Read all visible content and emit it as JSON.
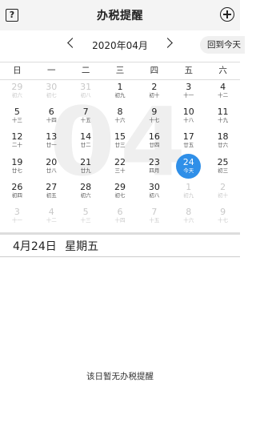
{
  "header": {
    "help_icon_glyph": "?",
    "help_icon": "question-icon",
    "title": "办税提醒",
    "add_icon": "plus-circle-icon"
  },
  "month_nav": {
    "prev_icon": "chevron-left-icon",
    "label": "2020年04月",
    "next_icon": "chevron-right-icon",
    "today_button": "回到今天"
  },
  "weekdays": [
    "日",
    "一",
    "二",
    "三",
    "四",
    "五",
    "六"
  ],
  "watermark": "04",
  "calendar": {
    "selected_color": "#2f8fe8",
    "days": [
      {
        "day": "29",
        "lunar": "初六",
        "other": true
      },
      {
        "day": "30",
        "lunar": "初七",
        "other": true
      },
      {
        "day": "31",
        "lunar": "初八",
        "other": true
      },
      {
        "day": "1",
        "lunar": "初九"
      },
      {
        "day": "2",
        "lunar": "初十"
      },
      {
        "day": "3",
        "lunar": "十一"
      },
      {
        "day": "4",
        "lunar": "十二"
      },
      {
        "day": "5",
        "lunar": "十三"
      },
      {
        "day": "6",
        "lunar": "十四"
      },
      {
        "day": "7",
        "lunar": "十五"
      },
      {
        "day": "8",
        "lunar": "十六"
      },
      {
        "day": "9",
        "lunar": "十七"
      },
      {
        "day": "10",
        "lunar": "十八"
      },
      {
        "day": "11",
        "lunar": "十九"
      },
      {
        "day": "12",
        "lunar": "二十"
      },
      {
        "day": "13",
        "lunar": "廿一"
      },
      {
        "day": "14",
        "lunar": "廿二"
      },
      {
        "day": "15",
        "lunar": "廿三"
      },
      {
        "day": "16",
        "lunar": "廿四"
      },
      {
        "day": "17",
        "lunar": "廿五"
      },
      {
        "day": "18",
        "lunar": "廿六"
      },
      {
        "day": "19",
        "lunar": "廿七"
      },
      {
        "day": "20",
        "lunar": "廿八"
      },
      {
        "day": "21",
        "lunar": "廿九"
      },
      {
        "day": "22",
        "lunar": "三十"
      },
      {
        "day": "23",
        "lunar": "四月"
      },
      {
        "day": "24",
        "lunar": "今天",
        "selected": true
      },
      {
        "day": "25",
        "lunar": "初三"
      },
      {
        "day": "26",
        "lunar": "初四"
      },
      {
        "day": "27",
        "lunar": "初五"
      },
      {
        "day": "28",
        "lunar": "初六"
      },
      {
        "day": "29",
        "lunar": "初七"
      },
      {
        "day": "30",
        "lunar": "初八"
      },
      {
        "day": "1",
        "lunar": "初九",
        "other": true
      },
      {
        "day": "2",
        "lunar": "初十",
        "other": true
      },
      {
        "day": "3",
        "lunar": "十一",
        "other": true
      },
      {
        "day": "4",
        "lunar": "十二",
        "other": true
      },
      {
        "day": "5",
        "lunar": "十三",
        "other": true
      },
      {
        "day": "6",
        "lunar": "十四",
        "other": true
      },
      {
        "day": "7",
        "lunar": "十五",
        "other": true
      },
      {
        "day": "8",
        "lunar": "十六",
        "other": true
      },
      {
        "day": "9",
        "lunar": "十七",
        "other": true
      }
    ]
  },
  "selected_date": {
    "label": "4月24日 星期五"
  },
  "empty_message": "该日暂无办税提醒"
}
